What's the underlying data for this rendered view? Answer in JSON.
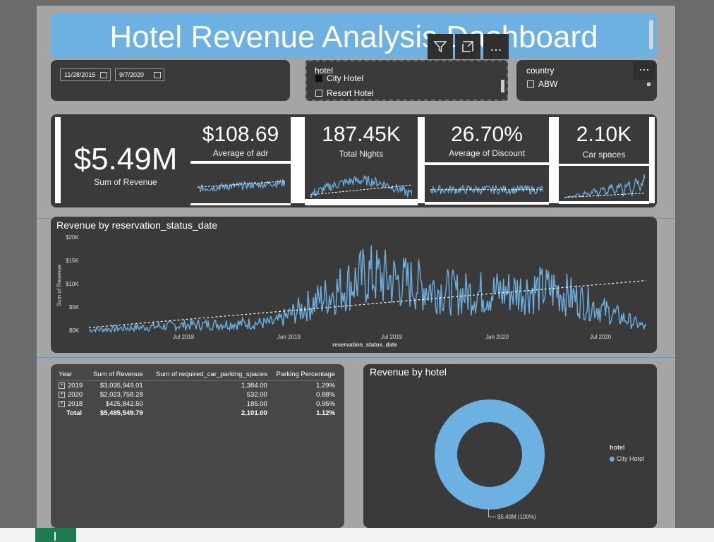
{
  "header": {
    "title": "Hotel Revenue Analysis Dashboard"
  },
  "toolbar": {
    "filter_icon": "filter-icon",
    "focus_icon": "focus-mode-icon",
    "more_label": "..."
  },
  "date_slicer": {
    "start": "11/28/2015",
    "end": "9/7/2020"
  },
  "hotel_slicer": {
    "title": "hotel",
    "options": [
      "City Hotel",
      "Resort Hotel"
    ]
  },
  "country_slicer": {
    "title": "country",
    "options": [
      "ABW"
    ],
    "more_label": "..."
  },
  "kpis": {
    "revenue": {
      "value": "$5.49M",
      "label": "Sum of Revenue"
    },
    "adr": {
      "value": "$108.69",
      "label": "Average of adr"
    },
    "nights": {
      "value": "187.45K",
      "label": "Total Nights"
    },
    "discount": {
      "value": "26.70%",
      "label": "Average of Discount"
    },
    "car": {
      "value": "2.10K",
      "label": "Car spaces"
    }
  },
  "revenue_chart": {
    "title": "Revenue by reservation_status_date",
    "ylabel": "Sum of Revenue",
    "xlabel": "reservation_status_date",
    "yticks": [
      "$20K",
      "$15K",
      "$10K",
      "$5K",
      "$0K"
    ],
    "xticks": [
      "Jul 2018",
      "Jan 2019",
      "Jul 2019",
      "Jan 2020",
      "Jul 2020"
    ]
  },
  "chart_data": [
    {
      "type": "line",
      "title": "Revenue by reservation_status_date",
      "xlabel": "reservation_status_date",
      "ylabel": "Sum of Revenue",
      "ylim": [
        0,
        20000
      ],
      "x": [
        "2018-01",
        "2018-07",
        "2019-01",
        "2019-07",
        "2020-01",
        "2020-07",
        "2020-09"
      ],
      "series": [
        {
          "values": [
            500,
            1500,
            2000,
            12000,
            8000,
            9000,
            1000
          ]
        },
        {
          "values": [
            1000,
            2600,
            4200,
            6600,
            8300,
            10100,
            10800
          ]
        }
      ],
      "grid": false
    },
    {
      "type": "pie",
      "title": "Revenue by hotel",
      "categories": [
        "City Hotel"
      ],
      "values": [
        5490000
      ],
      "labels": [
        "$5.49M (100%)"
      ],
      "legend_title": "hotel",
      "legend": "right"
    }
  ],
  "matrix": {
    "headers": [
      "Year",
      "Sum of Revenue",
      "Sum of required_car_parking_spaces",
      "Parking Percentage"
    ],
    "rows": [
      {
        "year": "2019",
        "revenue": "$3,035,949.01",
        "parking": "1,384.00",
        "pct": "1.29%"
      },
      {
        "year": "2020",
        "revenue": "$2,023,758.28",
        "parking": "532.00",
        "pct": "0.88%"
      },
      {
        "year": "2018",
        "revenue": "$425,842.50",
        "parking": "185.00",
        "pct": "0.95%"
      }
    ],
    "total": {
      "label": "Total",
      "revenue": "$5,485,549.79",
      "parking": "2,101.00",
      "pct": "1.12%"
    }
  },
  "donut": {
    "title": "Revenue by hotel",
    "legend_title": "hotel",
    "legend_item": "City Hotel",
    "data_label": "$5.49M (100%)"
  },
  "colors": {
    "accent": "#6cb1e1",
    "panel": "#3a3a3a",
    "canvas": "#a5a5a5"
  }
}
